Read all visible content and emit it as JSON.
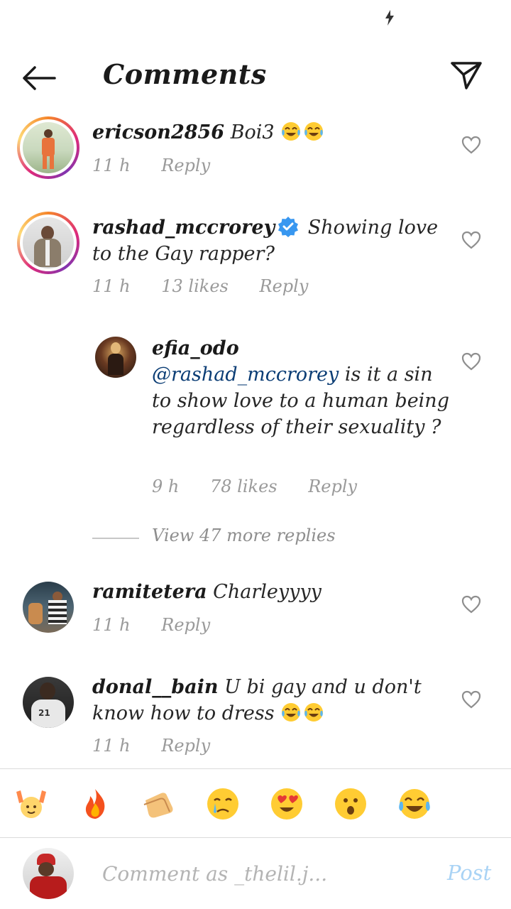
{
  "header": {
    "title": "Comments"
  },
  "comments": [
    {
      "username": "ericson2856",
      "text": "Boi3",
      "emojis": 2,
      "time": "11 h",
      "likes": "",
      "reply": "Reply"
    },
    {
      "username": "rashad_mccrorey",
      "verified": true,
      "text": "Showing love to the Gay rapper?",
      "time": "11 h",
      "likes": "13 likes",
      "reply": "Reply"
    },
    {
      "username": "efia_odo",
      "mention": "@rashad_mccrorey",
      "text": "is it a sin to show love to a human being regardless of their sexuality ?",
      "time": "9 h",
      "likes": "78 likes",
      "reply": "Reply"
    },
    {
      "username": "ramitetera",
      "text": "Charleyyyy",
      "time": "11 h",
      "likes": "",
      "reply": "Reply"
    },
    {
      "username": "donal__bain",
      "text": "U bi gay and u don't know how to dress",
      "emojis": 2,
      "time": "11 h",
      "likes": "",
      "reply": "Reply"
    }
  ],
  "view_replies": "View 47 more replies",
  "reactions": [
    "raising-hands-icon",
    "fire-icon",
    "clapping-hands-icon",
    "crying-face-icon",
    "heart-eyes-icon",
    "surprised-face-icon",
    "tears-of-joy-icon"
  ],
  "composer": {
    "placeholder": "Comment as _thelil.j...",
    "post_label": "Post"
  },
  "colors": {
    "mention": "#0b3d75",
    "verified": "#3897f0",
    "post_disabled": "#a9d3f5",
    "meta": "#9a9a9a"
  }
}
